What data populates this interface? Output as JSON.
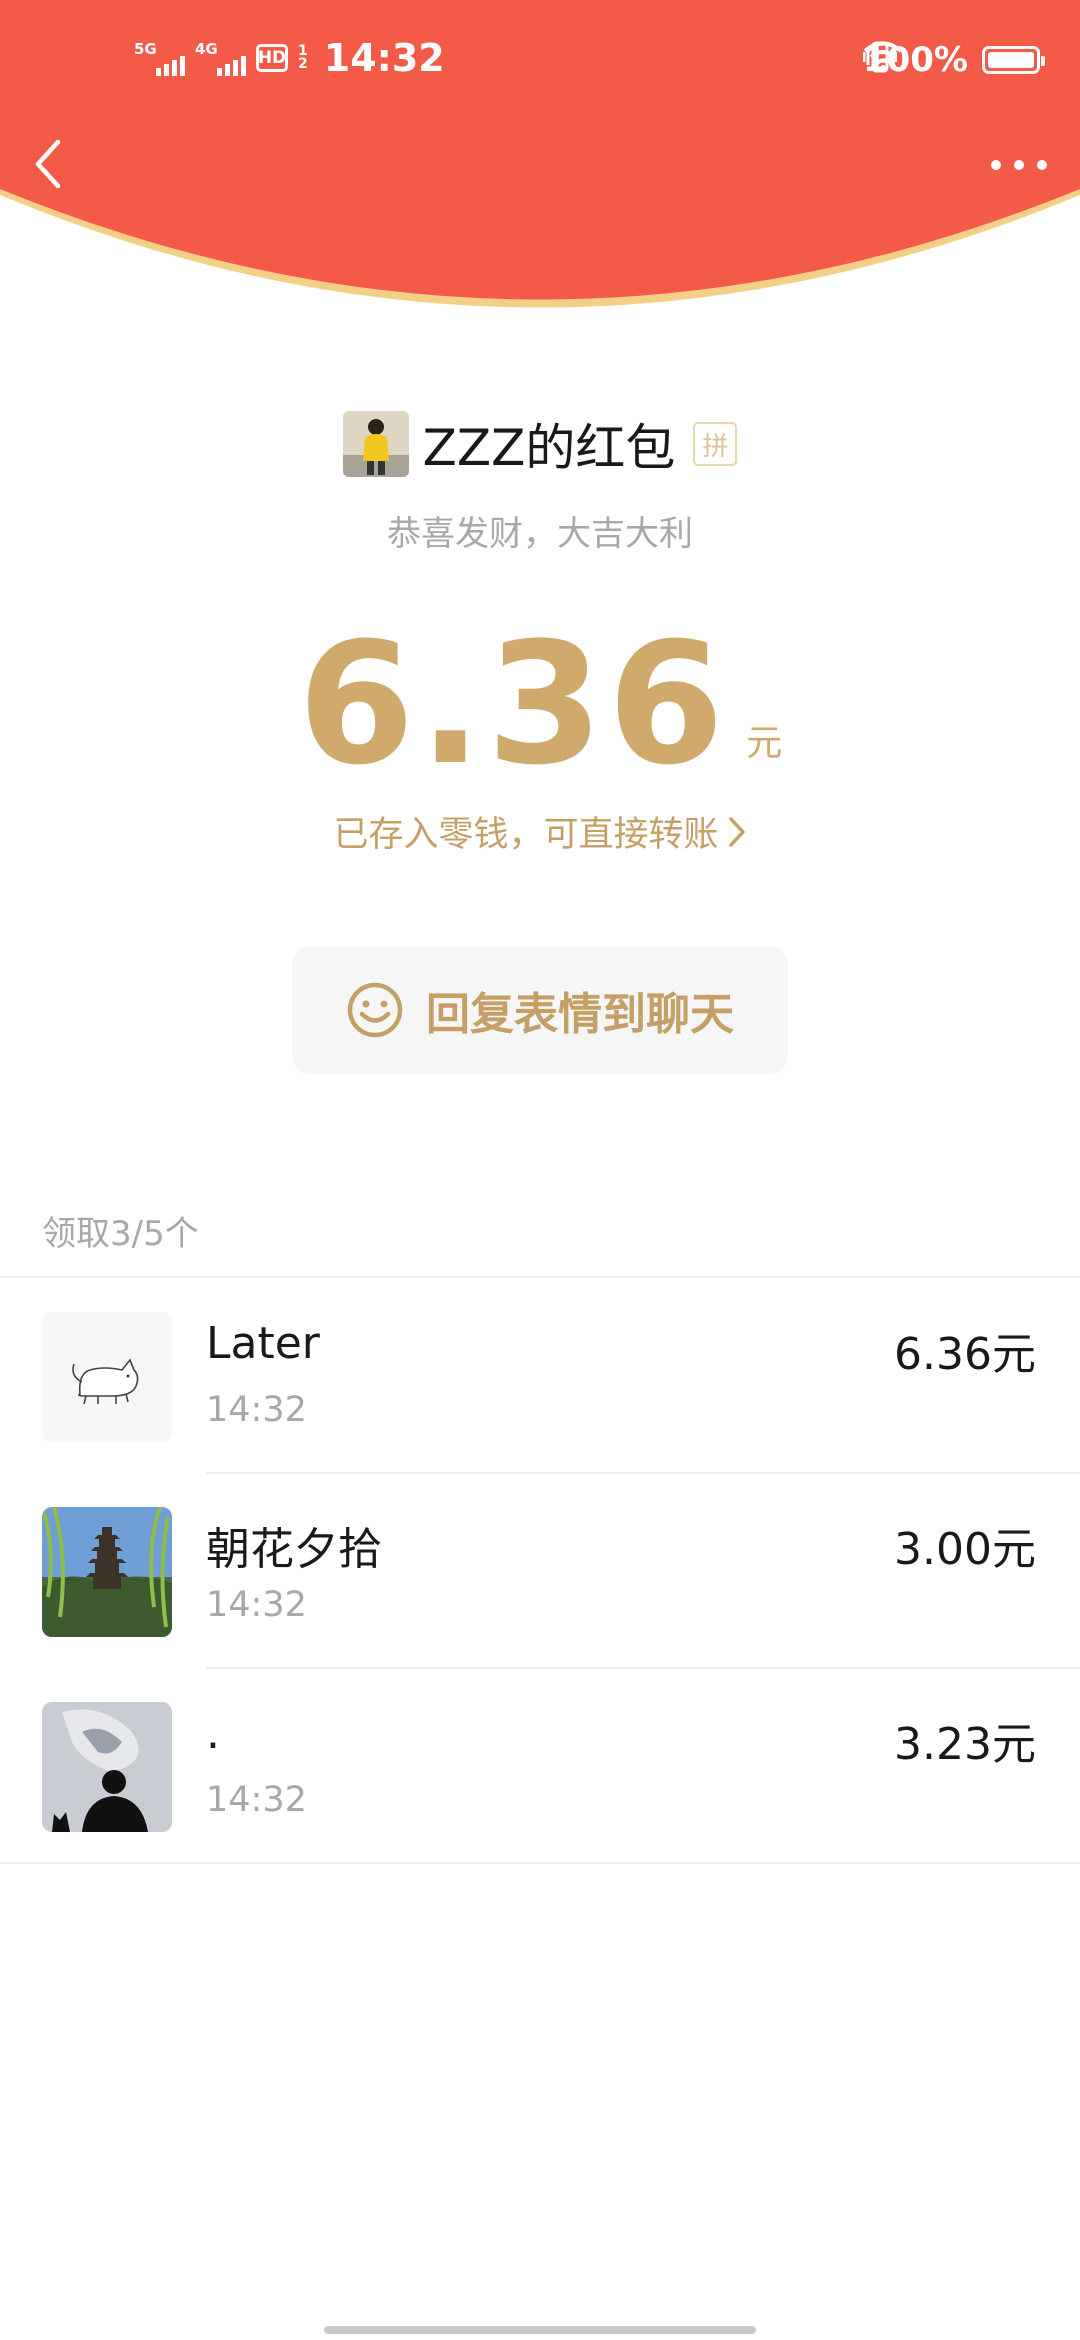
{
  "status_bar": {
    "signal1_tag": "5G",
    "signal2_tag": "4G",
    "hd_label": "HD",
    "hd_sub_1": "1",
    "hd_sub_2": "2",
    "time": "14:32",
    "battery_pct": "100%",
    "battery_level": 1.0
  },
  "header": {
    "color": "#f45a48",
    "back_icon": "chevron-left-icon",
    "more_icon": "more-dots-icon"
  },
  "packet": {
    "owner_name": "ZZZ的红包",
    "pin_badge": "拼",
    "wish": "恭喜发财，大吉大利",
    "amount": "6.36",
    "unit": "元",
    "stored_text": "已存入零钱，可直接转账",
    "reply_button": "回复表情到聊天",
    "accent_color": "#cfaa6c"
  },
  "receivers": {
    "count_label": "领取3/5个",
    "items": [
      {
        "name": "Later",
        "time": "14:32",
        "amount": "6.36元"
      },
      {
        "name": "朝花夕拾",
        "time": "14:32",
        "amount": "3.00元"
      },
      {
        "name": ".",
        "time": "14:32",
        "amount": "3.23元"
      }
    ]
  }
}
